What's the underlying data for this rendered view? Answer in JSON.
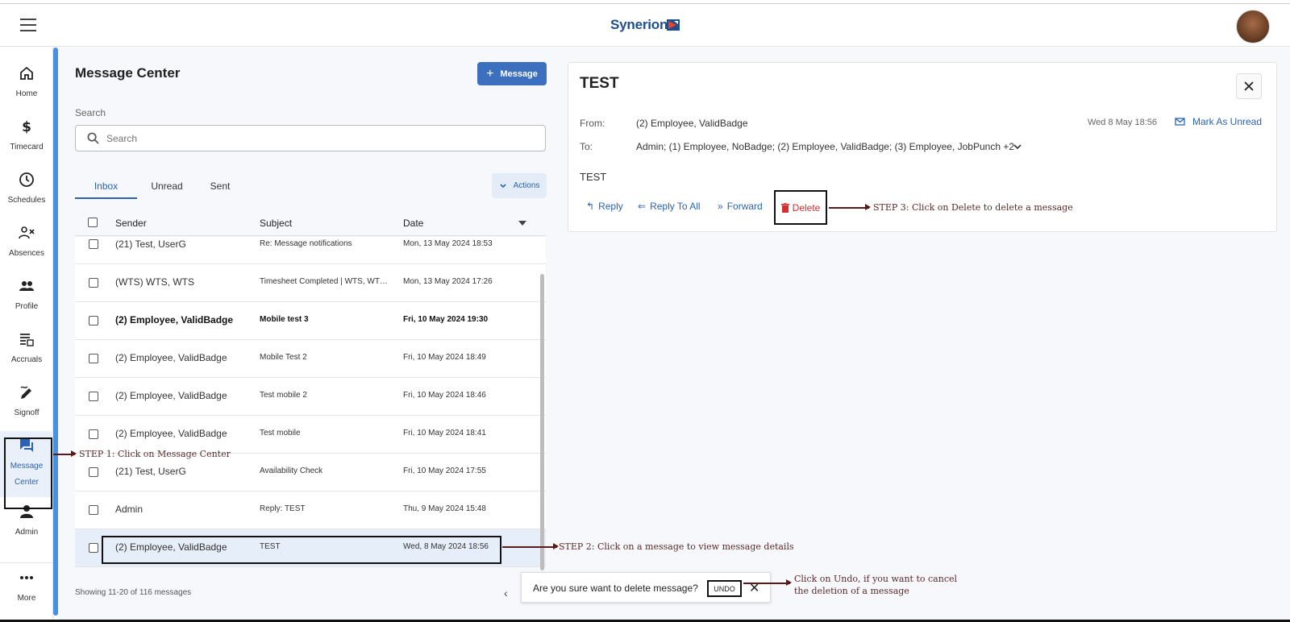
{
  "header": {
    "logo_text": "Synerion",
    "menu_icon": "hamburger-menu-icon",
    "avatar_icon": "user-avatar"
  },
  "nav": {
    "items": [
      {
        "label": "Home",
        "icon": "home-icon"
      },
      {
        "label": "Timecard",
        "icon": "dollar-icon"
      },
      {
        "label": "Schedules",
        "icon": "clock-icon"
      },
      {
        "label": "Absences",
        "icon": "person-x-icon"
      },
      {
        "label": "Profile",
        "icon": "people-icon"
      },
      {
        "label": "Accruals",
        "icon": "list-calculator-icon"
      },
      {
        "label": "Signoff",
        "icon": "pen-sign-icon"
      },
      {
        "label": "Message",
        "label2": "Center",
        "icon": "chat-icon",
        "active": true
      },
      {
        "label": "Admin",
        "icon": "person-icon"
      },
      {
        "label": "More",
        "icon": "more-dots-icon"
      }
    ]
  },
  "list": {
    "title": "Message Center",
    "new_message_label": "Message",
    "search_label": "Search",
    "search_placeholder": "Search",
    "tabs": [
      "Inbox",
      "Unread",
      "Sent"
    ],
    "active_tab": "Inbox",
    "actions_label": "Actions",
    "columns": {
      "sender": "Sender",
      "subject": "Subject",
      "date": "Date"
    },
    "rows": [
      {
        "sender": "(21) Test, UserG",
        "subject": "Re: Message notifications",
        "date": "Mon, 13 May 2024 18:53"
      },
      {
        "sender": "(WTS) WTS, WTS",
        "subject": "Timesheet Completed | WTS, WTS ...",
        "date": "Mon, 13 May 2024 17:26"
      },
      {
        "sender": "(2) Employee, ValidBadge",
        "subject": "Mobile test 3",
        "date": "Fri, 10 May 2024 19:30",
        "unread": true
      },
      {
        "sender": "(2) Employee, ValidBadge",
        "subject": "Mobile Test 2",
        "date": "Fri, 10 May 2024 18:49"
      },
      {
        "sender": "(2) Employee, ValidBadge",
        "subject": "Test mobile 2",
        "date": "Fri, 10 May 2024 18:46"
      },
      {
        "sender": "(2) Employee, ValidBadge",
        "subject": "Test mobile",
        "date": "Fri, 10 May 2024 18:41"
      },
      {
        "sender": "(21) Test, UserG",
        "subject": "Availability Check",
        "date": "Fri, 10 May 2024 17:55"
      },
      {
        "sender": "Admin",
        "subject": "Reply: TEST",
        "date": "Thu, 9 May 2024 15:48"
      },
      {
        "sender": "(2) Employee, ValidBadge",
        "subject": "TEST",
        "date": "Wed, 8 May 2024 18:56",
        "selected": true
      }
    ],
    "showing_text": "Showing 11-20 of 116 messages"
  },
  "detail": {
    "title": "TEST",
    "from_label": "From:",
    "from_value": "(2) Employee, ValidBadge",
    "to_label": "To:",
    "to_value": "Admin;  (1) Employee, NoBadge;  (2) Employee, ValidBadge;  (3) Employee, JobPunch  +2",
    "date": "Wed 8 May 18:56",
    "mark_unread_label": "Mark As Unread",
    "body": "TEST",
    "reply_label": "Reply",
    "reply_all_label": "Reply To All",
    "forward_label": "Forward",
    "delete_label": "Delete"
  },
  "toast": {
    "message": "Are you sure want to delete message?",
    "undo_label": "UNDO"
  },
  "annotations": {
    "step1": "STEP 1: Click on Message Center",
    "step2": "STEP 2: Click on a message to view message details",
    "step3": "STEP 3: Click on Delete to delete a message",
    "undo_note_1": "Click on Undo, if you want to cancel",
    "undo_note_2": "the deletion of a message"
  },
  "colors": {
    "accent": "#3d6fbf",
    "link": "#2b63b4",
    "danger": "#d32f2f",
    "nav_stripe": "#4a90e2"
  }
}
